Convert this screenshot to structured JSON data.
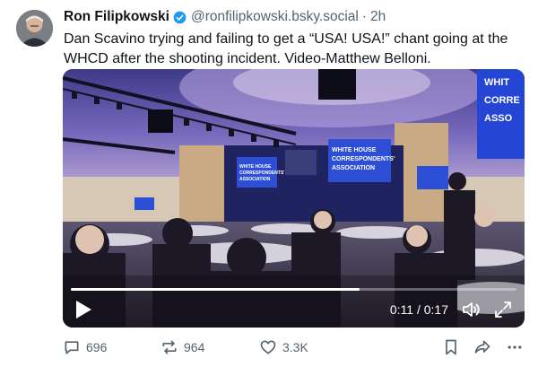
{
  "post": {
    "author": {
      "display_name": "Ron Filipkowski",
      "handle": "@ronfilipkowski.bsky.social",
      "separator": "·",
      "time": "2h",
      "verified": true
    },
    "text": "Dan Scavino trying and failing to get a “USA! USA!” chant going at the WHCD after the shooting incident. Video-Matthew Belloni.",
    "video": {
      "elapsed": "0:11",
      "duration": "0:17",
      "time_display": "0:11 / 0:17",
      "progress_fraction": 0.647,
      "screen_text": {
        "screen_left": "WHITE HOUSE CORRESPONDENTS' ASSOCIATION",
        "screen_center": "WHITE HOUSE CORRESPONDENTS' ASSOCIATION",
        "screen_right_lines": [
          "WHIT",
          "CORRE",
          "ASSO"
        ]
      }
    },
    "actions": {
      "replies": "696",
      "reposts": "964",
      "likes": "3.3K"
    }
  },
  "colors": {
    "verified_blue": "#1d9bf0",
    "muted_text": "#536471",
    "primary_text": "#0f1419"
  },
  "icons": [
    "verified-badge-icon",
    "play-icon",
    "volume-icon",
    "fullscreen-icon",
    "reply-icon",
    "repost-icon",
    "like-icon",
    "bookmark-icon",
    "share-icon",
    "more-icon"
  ]
}
